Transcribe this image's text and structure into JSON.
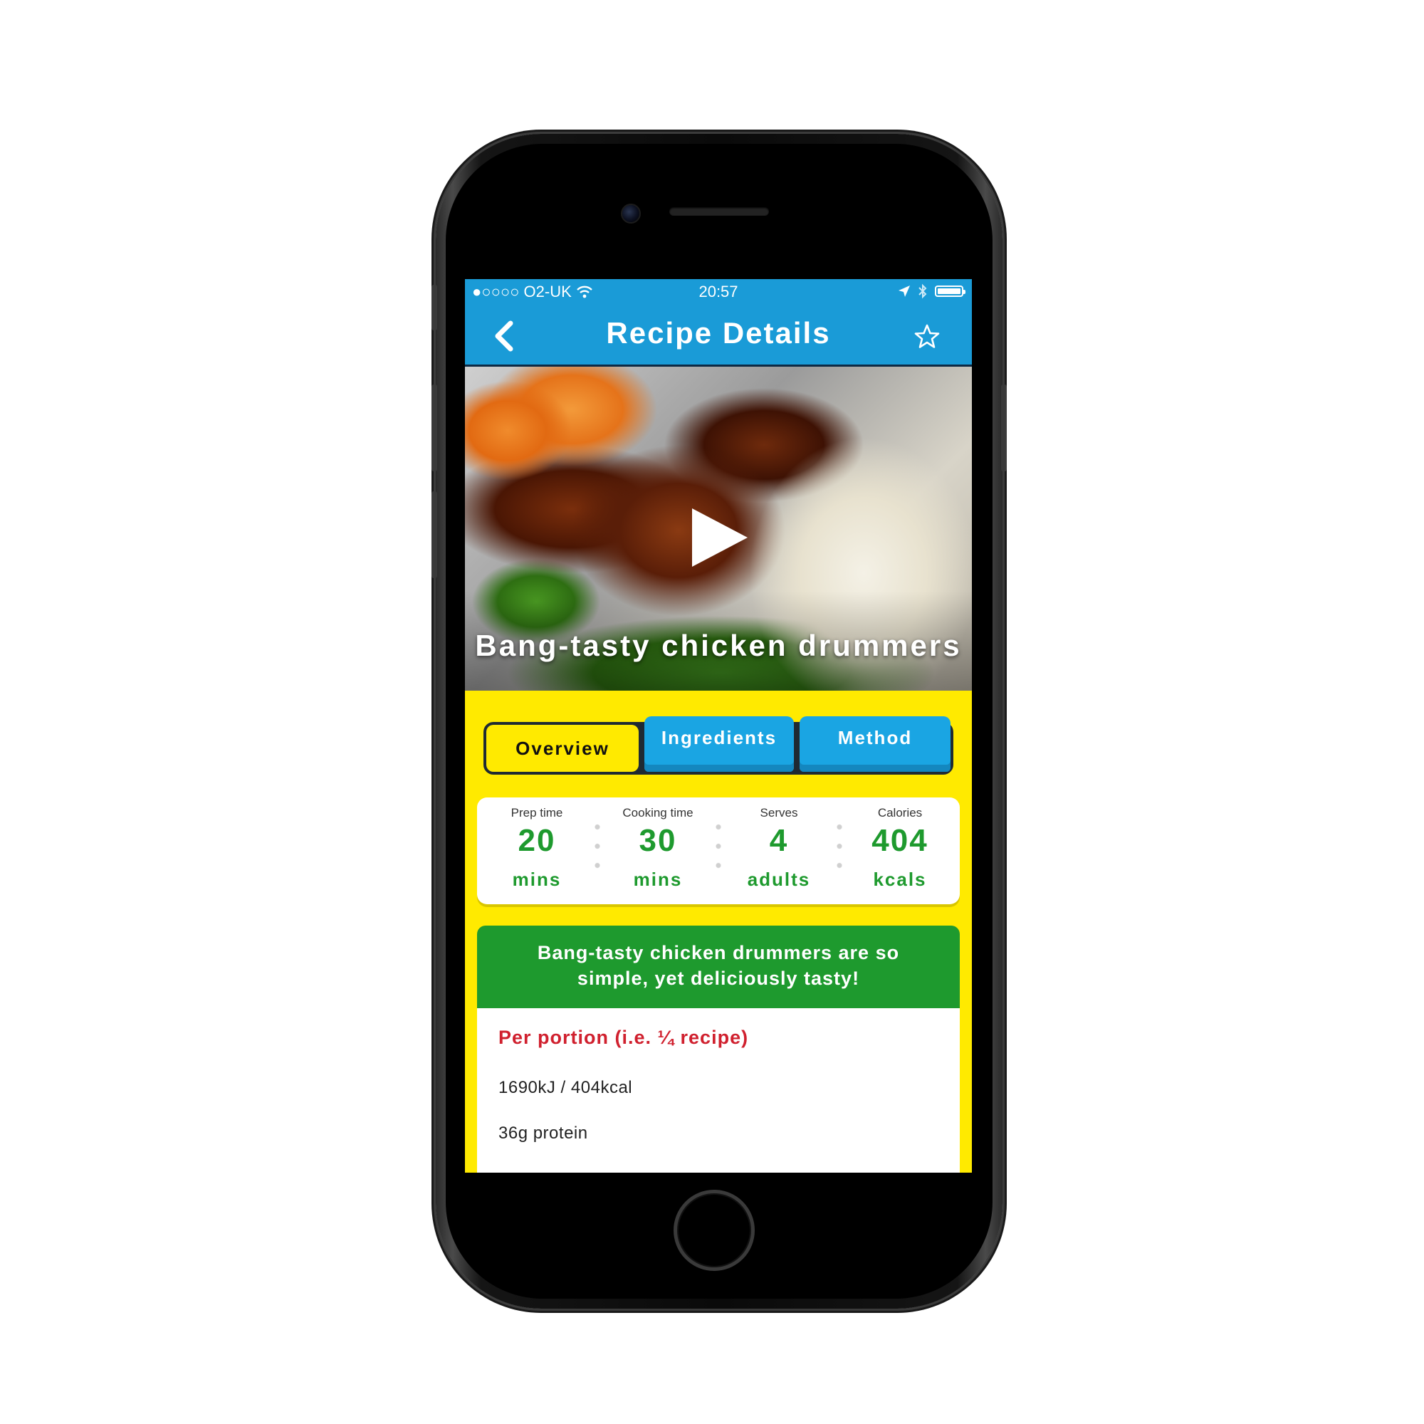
{
  "status_bar": {
    "carrier": "●○○○○ O2-UK",
    "time": "20:57"
  },
  "navbar": {
    "title": "Recipe Details",
    "back_icon": "chevron-left-icon",
    "favorite_icon": "star-outline-icon"
  },
  "hero": {
    "recipe_title": "Bang-tasty chicken drummers",
    "play_icon": "play-icon"
  },
  "tabs": [
    {
      "label": "Overview",
      "active": true
    },
    {
      "label": "Ingredients",
      "active": false
    },
    {
      "label": "Method",
      "active": false
    }
  ],
  "stats": [
    {
      "label": "Prep time",
      "value": "20",
      "unit": "mins"
    },
    {
      "label": "Cooking time",
      "value": "30",
      "unit": "mins"
    },
    {
      "label": "Serves",
      "value": "4",
      "unit": "adults"
    },
    {
      "label": "Calories",
      "value": "404",
      "unit": "kcals"
    }
  ],
  "description": "Bang-tasty chicken drummers are so simple, yet deliciously tasty!",
  "nutrition": {
    "title": "Per portion (i.e. ¼ recipe)",
    "lines": [
      "1690kJ / 404kcal",
      "36g protein"
    ]
  },
  "colors": {
    "header_blue": "#1a9bd7",
    "background_yellow": "#ffea00",
    "accent_green": "#1e9a2e",
    "heading_red": "#d0202e"
  }
}
